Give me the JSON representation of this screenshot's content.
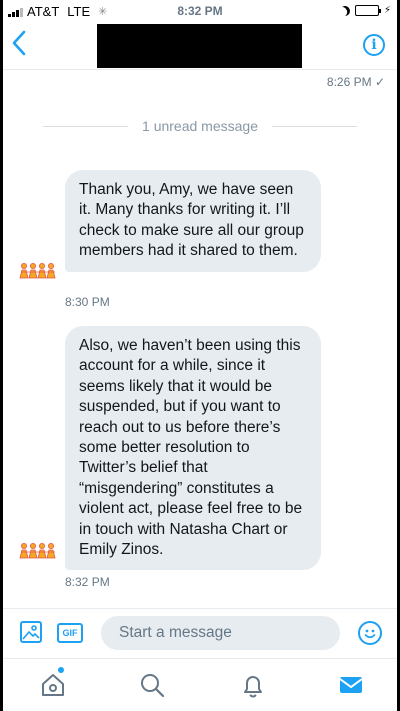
{
  "status_bar": {
    "carrier": "AT&T",
    "network": "LTE",
    "time": "8:32 PM"
  },
  "header": {
    "back_icon": "chevron-left-icon",
    "info_icon": "info-icon"
  },
  "conversation": {
    "last_sent_time": "8:26 PM ✓",
    "unread_divider": "1 unread message",
    "messages": [
      {
        "text": "Thank you, Amy, we have seen it. Many thanks for writing it. I’ll check to make sure all our group members had it shared to them.",
        "time": "8:30 PM"
      },
      {
        "text": "Also, we haven’t been using this account for a while, since it seems likely that it would be suspended, but if you want to reach out to us before there’s some better resolution to Twitter’s belief that “misgendering” constitutes a violent act, please feel free to be in touch with Natasha Chart or Emily Zinos.",
        "time": "8:32 PM"
      }
    ]
  },
  "composer": {
    "placeholder": "Start a message",
    "gif_label": "GIF"
  },
  "colors": {
    "accent": "#1da1f2",
    "bubble": "#e6ecf0",
    "muted_text": "#657786"
  }
}
